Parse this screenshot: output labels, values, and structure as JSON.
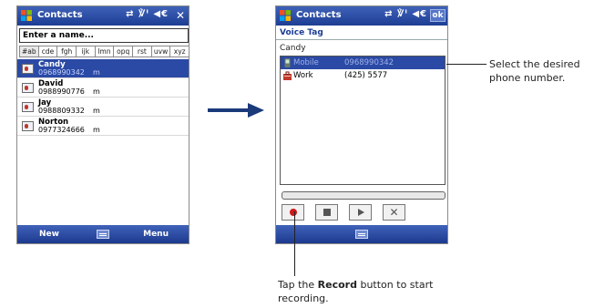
{
  "colors": {
    "titlebar": "#1d3d94",
    "selection": "#2b4aa5",
    "arrow": "#1a3a7a",
    "record": "#d01818"
  },
  "left_phone": {
    "title": "Contacts",
    "status_icons": "⇄ ℣ᴵ ◀€",
    "close": "✕",
    "name_placeholder": "Enter a name...",
    "alpha_tabs": [
      "#ab",
      "cde",
      "fgh",
      "ijk",
      "lmn",
      "opq",
      "rst",
      "uvw",
      "xyz"
    ],
    "contacts": [
      {
        "name": "Candy",
        "number": "0968990342",
        "type": "m"
      },
      {
        "name": "David",
        "number": "0988990776",
        "type": "m"
      },
      {
        "name": "Jay",
        "number": "0988809332",
        "type": "m"
      },
      {
        "name": "Norton",
        "number": "0977324666",
        "type": "m"
      }
    ],
    "softkeys": {
      "left": "New",
      "right": "Menu"
    }
  },
  "right_phone": {
    "title": "Contacts",
    "status_icons": "⇄ ℣ᴵ ◀€",
    "ok": "ok",
    "header": "Voice Tag",
    "contact_name": "Candy",
    "numbers": [
      {
        "label": "Mobile",
        "value": "0968990342",
        "icon": "mobile-icon"
      },
      {
        "label": "Work",
        "value": "(425) 5577",
        "icon": "work-icon"
      }
    ],
    "controls": [
      "record-icon",
      "stop-icon",
      "play-icon",
      "delete-icon"
    ]
  },
  "callouts": {
    "right": "Select the desired phone number.",
    "bottom_prefix": "Tap the ",
    "bottom_bold": "Record",
    "bottom_suffix": " button to start recording."
  }
}
